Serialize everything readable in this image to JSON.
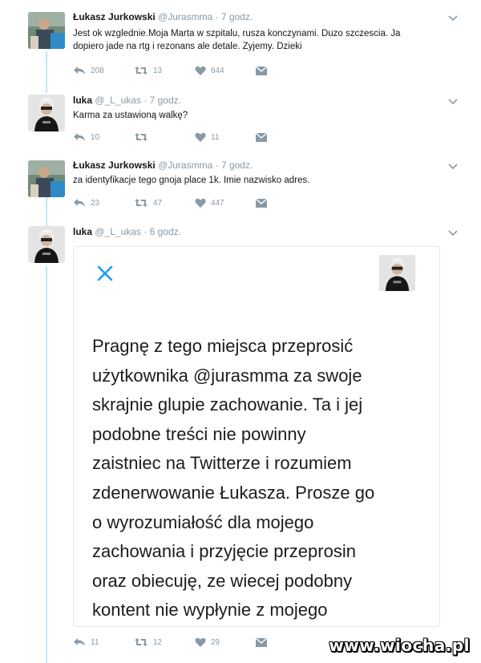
{
  "tweets": [
    {
      "name": "Łukasz Jurkowski",
      "handle": "@Jurasmma",
      "time": "· 7 godz.",
      "text_lines": [
        "Jest ok wzglednie.Moja Marta w szpitalu, rusza konczynami. Duzo szczescia. Ja",
        "dopiero jade na rtg i rezonans ale detale. Zyjemy. Dzieki"
      ],
      "replies": "208",
      "retweets": "13",
      "likes": "644"
    },
    {
      "name": "luka",
      "handle": "@_L_ukas",
      "time": "· 7 godz.",
      "text_lines": [
        "Karma za ustawioną walkę?"
      ],
      "replies": "10",
      "retweets": "",
      "likes": "11"
    },
    {
      "name": "Łukasz Jurkowski",
      "handle": "@Jurasmma",
      "time": "· 7 godz.",
      "text_lines": [
        "za identyfikacje tego gnoja place 1k. Imie nazwisko adres."
      ],
      "replies": "23",
      "retweets": "47",
      "likes": "447"
    },
    {
      "name": "luka",
      "handle": "@_L_ukas",
      "time": "· 6 godz.",
      "text_lines": [],
      "replies": "11",
      "retweets": "12",
      "likes": "29"
    }
  ],
  "card": {
    "lines": [
      "Pragnę z tego miejsca przeprosić",
      "użytkownika @jurasmma za swoje",
      "skrajnie glupie zachowanie. Ta i jej",
      "podobne treści nie powinny",
      "zaistniec na Twitterze i rozumiem",
      "zdenerwowanie Łukasza. Prosze go",
      "o wyrozumiałość dla mojego",
      "zachowania i przyjęcie przeprosin",
      "oraz obiecuję, ze wiecej podobny",
      "kontent nie wypłynie z mojego"
    ]
  },
  "watermark": "www.wiocha.pl",
  "colors": {
    "thread_line": "#c4e4f6",
    "meta_gray": "#8899a6",
    "close_blue": "#1da1f2"
  }
}
